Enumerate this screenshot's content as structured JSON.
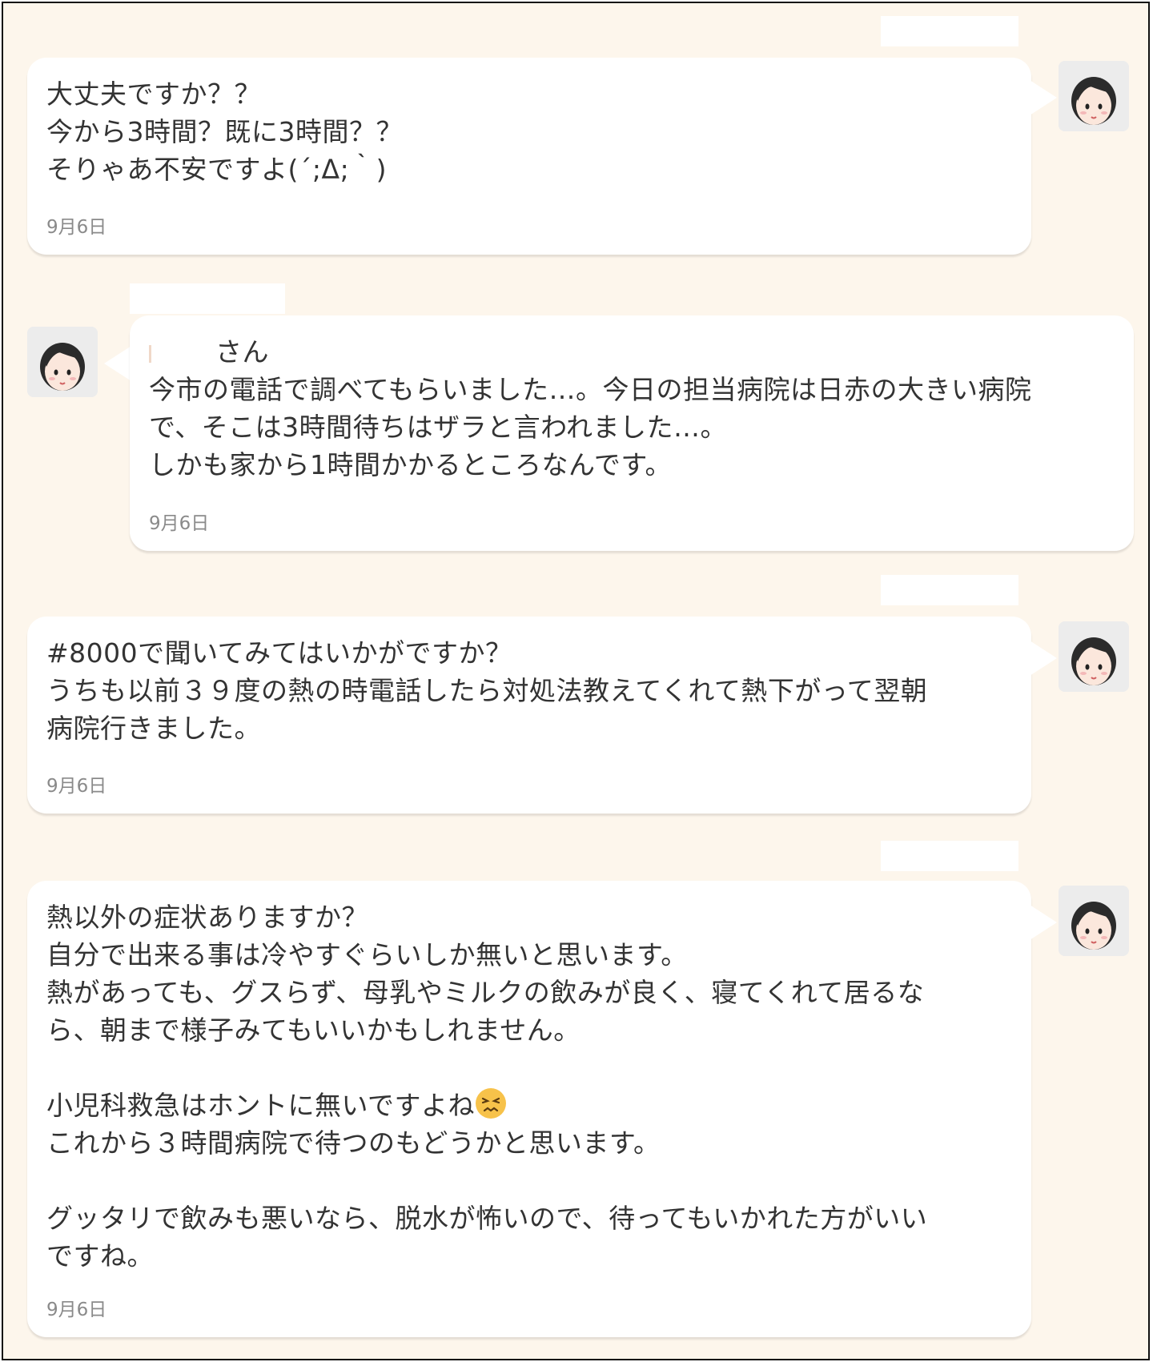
{
  "messages": [
    {
      "side": "right",
      "avatar_icon": "avatar-woman-icon",
      "lines": [
        "大丈夫ですか？？",
        "今から3時間？既に3時間？？",
        "そりゃあ不安ですよ(´;ᐃ;｀)"
      ],
      "date": "9月6日"
    },
    {
      "side": "left",
      "avatar_icon": "avatar-woman-icon",
      "salutation": "さん",
      "lines": [
        "今市の電話で調べてもらいました…。今日の担当病院は日赤の大きい病院",
        "で、そこは3時間待ちはザラと言われました…。",
        "しかも家から1時間かかるところなんです。"
      ],
      "date": "9月6日"
    },
    {
      "side": "right",
      "avatar_icon": "avatar-woman-icon",
      "lines": [
        "#8000で聞いてみてはいかがですか？",
        "うちも以前３９度の熱の時電話したら対処法教えてくれて熱下がって翌朝",
        "病院行きました。"
      ],
      "date": "9月6日"
    },
    {
      "side": "right",
      "avatar_icon": "avatar-woman-icon",
      "lines": [
        "熱以外の症状ありますか？",
        "自分で出来る事は冷やすぐらいしか無いと思います。",
        "熱があっても、グスらず、母乳やミルクの飲みが良く、寝てくれて居るな",
        "ら、朝まで様子みてもいいかもしれません。",
        "",
        "小児科救急はホントに無いですよね",
        "これから３時間病院で待つのもどうかと思います。",
        "",
        "グッタリで飲みも悪いなら、脱水が怖いので、待ってもいかれた方がいい",
        "ですね。"
      ],
      "emoji_icon": "persevering-face-emoji-icon",
      "date": "9月6日"
    }
  ],
  "colors": {
    "background": "#fdf6ec",
    "bubble": "#ffffff",
    "text": "#333333",
    "date": "#8a8a8a",
    "border": "#111111"
  }
}
